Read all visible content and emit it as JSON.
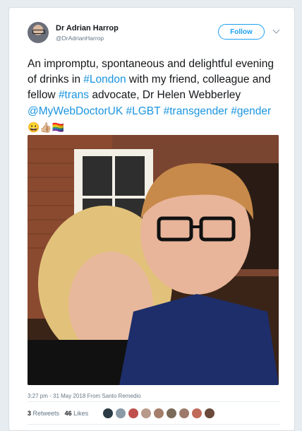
{
  "tweet": {
    "display_name": "Dr Adrian Harrop",
    "handle": "@DrAdrianHarrop",
    "follow_label": "Follow",
    "text_segments": [
      {
        "t": "An impromptu, spontaneous and delightful evening of drinks in ",
        "link": false
      },
      {
        "t": "#London",
        "link": true
      },
      {
        "t": " with my friend, colleague and fellow ",
        "link": false
      },
      {
        "t": "#trans",
        "link": true
      },
      {
        "t": " advocate, Dr Helen Webberley ",
        "link": false
      },
      {
        "t": "@MyWebDoctorUK",
        "link": true
      },
      {
        "t": " ",
        "link": false
      },
      {
        "t": "#LGBT",
        "link": true
      },
      {
        "t": " ",
        "link": false
      },
      {
        "t": "#transgender",
        "link": true
      },
      {
        "t": " ",
        "link": false
      },
      {
        "t": "#gender",
        "link": true
      },
      {
        "t": " 😀👍🏼🏳️‍🌈",
        "link": false,
        "emoji": true
      }
    ],
    "timestamp": "3:27 pm - 31 May 2018",
    "source_prefix": "From",
    "source": "Santo Remedio",
    "retweets_count": "3",
    "retweets_label": "Retweets",
    "likes_count": "46",
    "likes_label": "Likes"
  },
  "colors": {
    "link": "#1b95e0",
    "follow": "#1da1f2",
    "likers": [
      "#2b3a44",
      "#8a9aa6",
      "#c0504d",
      "#b89a8a",
      "#a47e6a",
      "#7b6a5a",
      "#9e7a6a",
      "#c06a5a",
      "#6a4a3a"
    ]
  },
  "icons": [
    "chevron-down-icon"
  ]
}
